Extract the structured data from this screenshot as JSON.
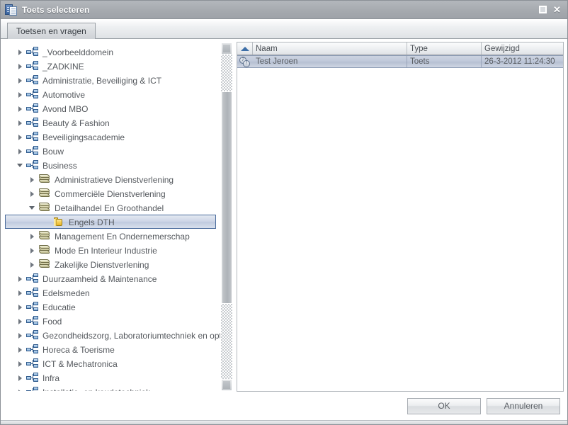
{
  "window": {
    "title": "Toets selecteren",
    "icon": "documents-icon",
    "controls": {
      "maximize": "maximize-icon",
      "close": "✕"
    }
  },
  "tabs": [
    {
      "label": "Toetsen en vragen",
      "active": true
    }
  ],
  "tree": {
    "items": [
      {
        "label": "_Voorbeelddomein",
        "level": 0,
        "icon": "domain-icon",
        "state": "collapsed",
        "selected": false
      },
      {
        "label": "_ZADKINE",
        "level": 0,
        "icon": "domain-icon",
        "state": "collapsed",
        "selected": false
      },
      {
        "label": "Administratie, Beveiliging & ICT",
        "level": 0,
        "icon": "domain-icon",
        "state": "collapsed",
        "selected": false
      },
      {
        "label": "Automotive",
        "level": 0,
        "icon": "domain-icon",
        "state": "collapsed",
        "selected": false
      },
      {
        "label": "Avond MBO",
        "level": 0,
        "icon": "domain-icon",
        "state": "collapsed",
        "selected": false
      },
      {
        "label": "Beauty & Fashion",
        "level": 0,
        "icon": "domain-icon",
        "state": "collapsed",
        "selected": false
      },
      {
        "label": "Beveiligingsacademie",
        "level": 0,
        "icon": "domain-icon",
        "state": "collapsed",
        "selected": false
      },
      {
        "label": "Bouw",
        "level": 0,
        "icon": "domain-icon",
        "state": "collapsed",
        "selected": false
      },
      {
        "label": "Business",
        "level": 0,
        "icon": "domain-icon",
        "state": "expanded",
        "selected": false
      },
      {
        "label": "Administratieve Dienstverlening",
        "level": 1,
        "icon": "stack-icon",
        "state": "collapsed",
        "selected": false
      },
      {
        "label": "Commerciële Dienstverlening",
        "level": 1,
        "icon": "stack-icon",
        "state": "collapsed",
        "selected": false
      },
      {
        "label": "Detailhandel En Groothandel",
        "level": 1,
        "icon": "stack-icon",
        "state": "expanded",
        "selected": false
      },
      {
        "label": "Engels DTH",
        "level": 2,
        "icon": "folder-icon",
        "state": "leaf",
        "selected": true
      },
      {
        "label": "Management En Ondernemerschap",
        "level": 1,
        "icon": "stack-icon",
        "state": "collapsed",
        "selected": false
      },
      {
        "label": "Mode En Interieur Industrie",
        "level": 1,
        "icon": "stack-icon",
        "state": "collapsed",
        "selected": false
      },
      {
        "label": "Zakelijke Dienstverlening",
        "level": 1,
        "icon": "stack-icon",
        "state": "collapsed",
        "selected": false
      },
      {
        "label": "Duurzaamheid & Maintenance",
        "level": 0,
        "icon": "domain-icon",
        "state": "collapsed",
        "selected": false
      },
      {
        "label": "Edelsmeden",
        "level": 0,
        "icon": "domain-icon",
        "state": "collapsed",
        "selected": false
      },
      {
        "label": "Educatie",
        "level": 0,
        "icon": "domain-icon",
        "state": "collapsed",
        "selected": false
      },
      {
        "label": "Food",
        "level": 0,
        "icon": "domain-icon",
        "state": "collapsed",
        "selected": false
      },
      {
        "label": "Gezondheidszorg, Laboratoriumtechniek en optiek",
        "level": 0,
        "icon": "domain-icon",
        "state": "collapsed",
        "selected": false
      },
      {
        "label": "Horeca & Toerisme",
        "level": 0,
        "icon": "domain-icon",
        "state": "collapsed",
        "selected": false
      },
      {
        "label": "ICT & Mechatronica",
        "level": 0,
        "icon": "domain-icon",
        "state": "collapsed",
        "selected": false
      },
      {
        "label": "Infra",
        "level": 0,
        "icon": "domain-icon",
        "state": "collapsed",
        "selected": false
      },
      {
        "label": "Installatie- en koudetechniek",
        "level": 0,
        "icon": "domain-icon",
        "state": "collapsed",
        "selected": false
      }
    ]
  },
  "list": {
    "sort_column": "Naam",
    "sort_direction": "ascending",
    "columns": [
      {
        "label": "Naam"
      },
      {
        "label": "Type"
      },
      {
        "label": "Gewijzigd"
      }
    ],
    "rows": [
      {
        "icon": "test-icon",
        "name": "Test Jeroen",
        "type": "Toets",
        "modified": "26-3-2012 11:24:30",
        "selected": true
      }
    ]
  },
  "footer": {
    "ok_label": "OK",
    "cancel_label": "Annuleren"
  },
  "colors": {
    "titlebar": "#a6aaaf",
    "selection_tree": "#c6d0e2",
    "selection_list": "#c0c9da",
    "sort_icon": "#3d6fa8",
    "folder": "#f6cf55",
    "domain_icon": "#7fa9d4"
  }
}
